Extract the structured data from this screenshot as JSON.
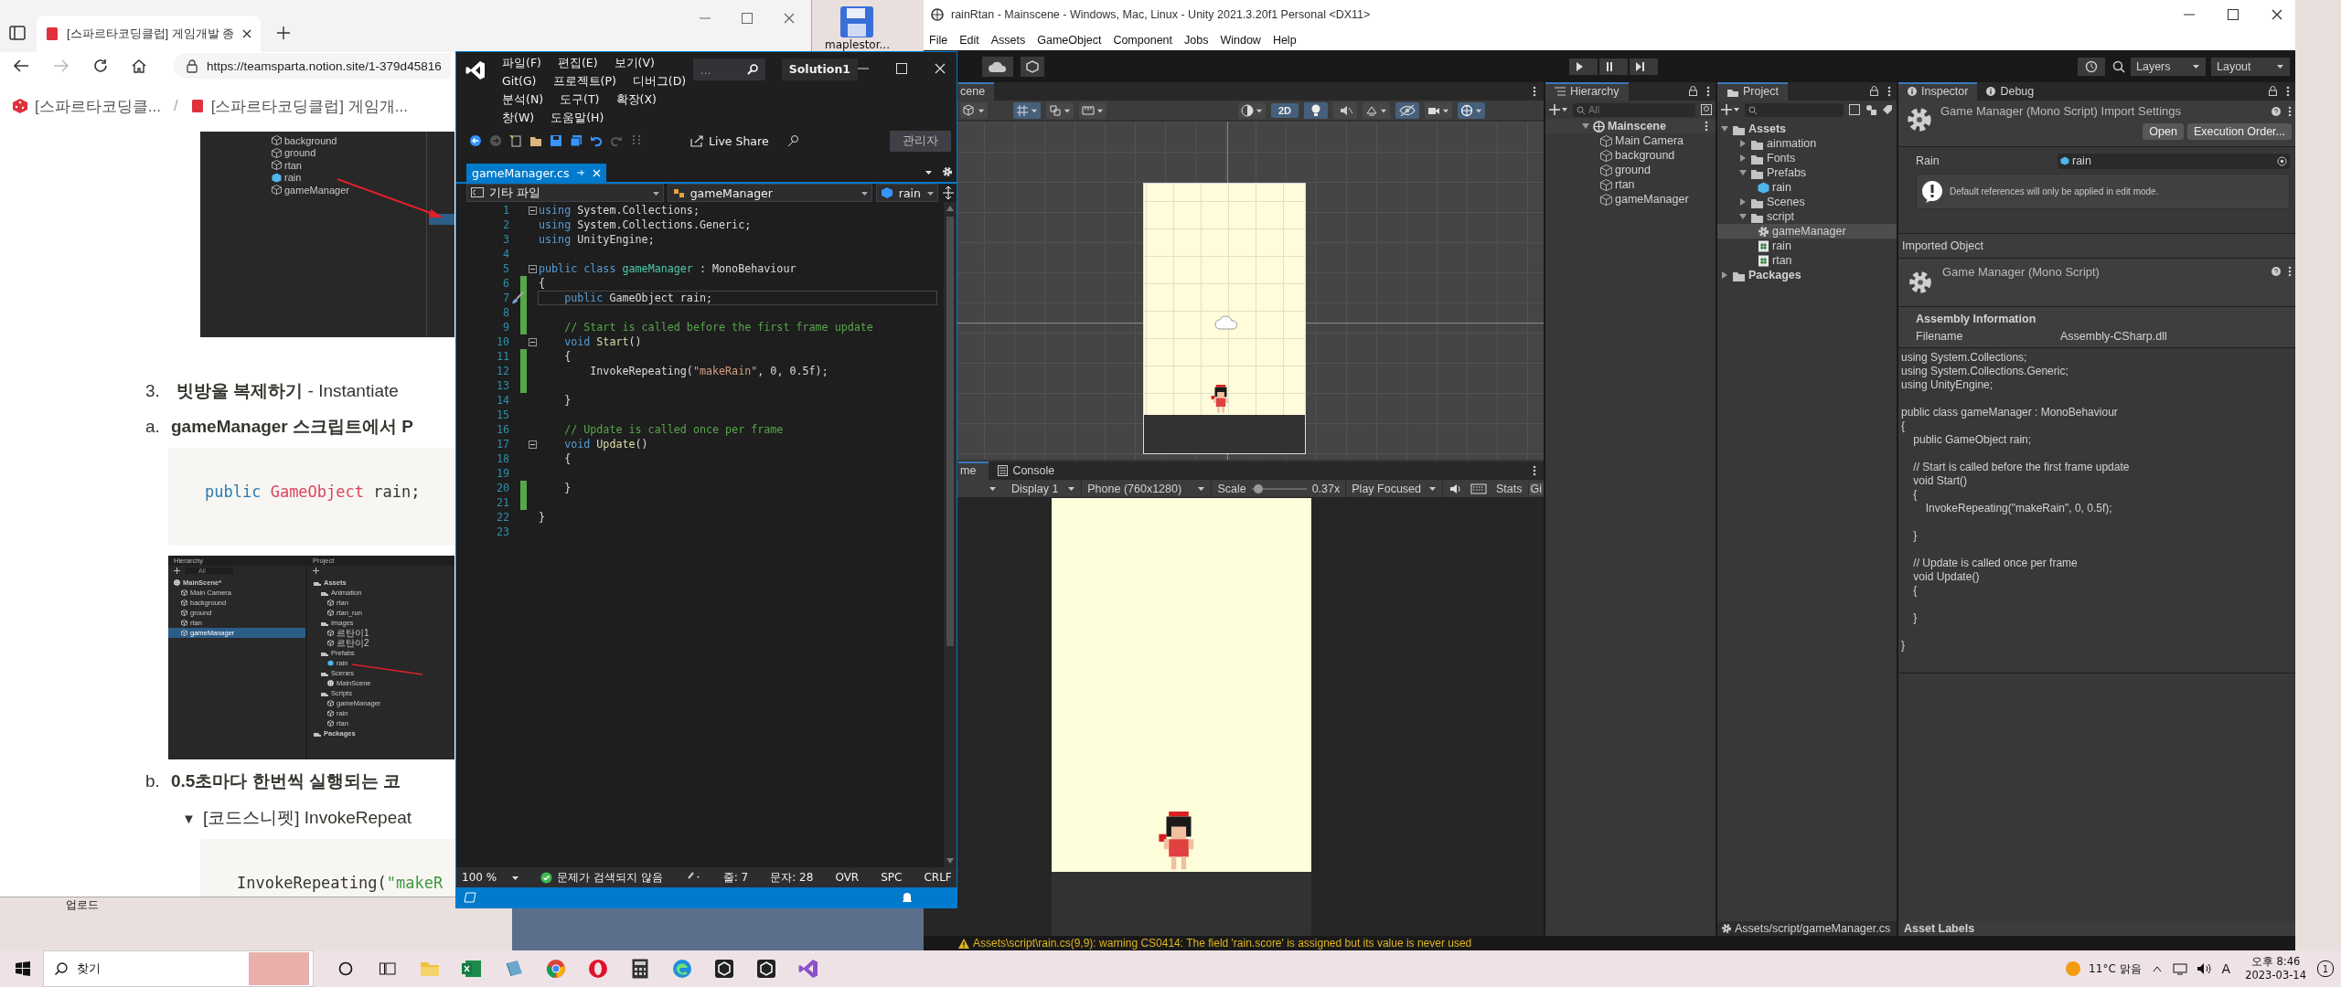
{
  "desktop_icons": [
    {
      "label": "maplestor..."
    },
    {
      "label": "업로드"
    }
  ],
  "browser": {
    "tab_title": "[스파르타코딩클럽] 게임개발 종",
    "address": "https://teamsparta.notion.site/1-379d45816",
    "breadcrumbs": [
      "[스파르타코딩클...",
      "[스파르타코딩클럽] 게임개..."
    ],
    "breadcrumb_separator": "/",
    "content": [
      {
        "kind": "screenshot_tree",
        "items": [
          {
            "label": "background",
            "kind": "object",
            "selected": false
          },
          {
            "label": "ground",
            "kind": "object",
            "selected": false
          },
          {
            "label": "rtan",
            "kind": "object",
            "selected": false
          },
          {
            "label": "rain",
            "kind": "prefab",
            "selected": false
          },
          {
            "label": "gameManager",
            "kind": "object",
            "selected": false
          }
        ]
      },
      {
        "kind": "heading",
        "number": "3.",
        "text": "**빗방울 복제하기** - Instantiate",
        "children": [
          {
            "kind": "subitem",
            "number": "a.",
            "text": "gameManager 스크립트에서 P",
            "children": [
              {
                "kind": "code",
                "tokens": [
                  {
                    "kind": "kw",
                    "text": "public "
                  },
                  {
                    "kind": "type",
                    "text": "GameObject"
                  },
                  {
                    "kind": "plain",
                    "text": " rain;"
                  }
                ]
              },
              {
                "kind": "screenshot_panels",
                "hierarchy": {
                  "title": "Hierarchy",
                  "search": "All",
                  "items": [
                    {
                      "label": "MainScene*",
                      "kind": "scene",
                      "selected": false,
                      "children": [
                        {
                          "label": "Main Camera",
                          "kind": "object",
                          "selected": false
                        },
                        {
                          "label": "background",
                          "kind": "object",
                          "selected": false
                        },
                        {
                          "label": "ground",
                          "kind": "object",
                          "selected": false
                        },
                        {
                          "label": "rtan",
                          "kind": "object",
                          "selected": false
                        },
                        {
                          "label": "gameManager",
                          "kind": "object",
                          "selected": true
                        }
                      ]
                    }
                  ]
                },
                "project": {
                  "title": "Project",
                  "items": [
                    {
                      "label": "Assets",
                      "kind": "folder",
                      "selected": false,
                      "children": [
                        {
                          "label": "Animation",
                          "kind": "folder",
                          "selected": false,
                          "children": [
                            {
                              "label": "rtan",
                              "kind": "object",
                              "selected": false
                            },
                            {
                              "label": "rtan_run",
                              "kind": "object",
                              "selected": false
                            }
                          ]
                        },
                        {
                          "label": "Images",
                          "kind": "folder",
                          "selected": false,
                          "children": [
                            {
                              "label": "르탄이1",
                              "kind": "object",
                              "selected": false
                            },
                            {
                              "label": "르탄이2",
                              "kind": "object",
                              "selected": false
                            }
                          ]
                        },
                        {
                          "label": "Prefabs",
                          "kind": "folder",
                          "selected": false,
                          "children": [
                            {
                              "label": "rain",
                              "kind": "prefab",
                              "selected": false
                            }
                          ]
                        },
                        {
                          "label": "Scenes",
                          "kind": "folder",
                          "selected": false,
                          "children": [
                            {
                              "label": "MainScene",
                              "kind": "scene",
                              "selected": false
                            }
                          ]
                        },
                        {
                          "label": "Scripts",
                          "kind": "folder",
                          "selected": false,
                          "children": [
                            {
                              "label": "gameManager",
                              "kind": "object",
                              "selected": false
                            },
                            {
                              "label": "rain",
                              "kind": "object",
                              "selected": false
                            },
                            {
                              "label": "rtan",
                              "kind": "object",
                              "selected": false
                            }
                          ]
                        }
                      ]
                    },
                    {
                      "label": "Packages",
                      "kind": "folder",
                      "selected": false
                    }
                  ]
                }
              }
            ]
          },
          {
            "kind": "subitem",
            "number": "b.",
            "text": "0.5초마다 한번씩 실행되는 코",
            "children": [
              {
                "kind": "toggle",
                "marker": "▼",
                "text": "[코드스니펫] InvokeRepeat",
                "expanded": true,
                "children": [
                  {
                    "kind": "code",
                    "tokens": [
                      {
                        "kind": "plain",
                        "text": "InvokeRepeating("
                      },
                      {
                        "kind": "str",
                        "text": "\"makeR"
                      }
                    ]
                  }
                ]
              }
            ]
          }
        ]
      }
    ]
  },
  "vs": {
    "menu": [
      "파일(F)",
      "편집(E)",
      "보기(V)",
      "Git(G)",
      "프로젝트(P)",
      "디버그(D)",
      "분석(N)",
      "도구(T)",
      "확장(X)",
      "창(W)",
      "도움말(H)"
    ],
    "search": "...",
    "solution": "Solution1",
    "live_share": "Live Share",
    "admin": "관리자",
    "tab": {
      "title": "gameManager.cs",
      "selected": true
    },
    "nav": [
      "기타 파일",
      "gameManager",
      "rain"
    ],
    "lines": [
      {
        "number": "1",
        "fold": true,
        "changed": false,
        "current": false,
        "tokens": [
          {
            "kind": "kw",
            "text": "using"
          },
          {
            "kind": "plain",
            "text": " System.Collections;"
          }
        ]
      },
      {
        "number": "2",
        "fold": false,
        "changed": false,
        "current": false,
        "tokens": [
          {
            "kind": "kw",
            "text": "using"
          },
          {
            "kind": "plain",
            "text": " System.Collections.Generic;"
          }
        ]
      },
      {
        "number": "3",
        "fold": false,
        "changed": false,
        "current": false,
        "tokens": [
          {
            "kind": "kw",
            "text": "using"
          },
          {
            "kind": "plain",
            "text": " UnityEngine;"
          }
        ]
      },
      {
        "number": "4",
        "fold": false,
        "changed": false,
        "current": false
      },
      {
        "number": "5",
        "fold": true,
        "changed": false,
        "current": false,
        "tokens": [
          {
            "kind": "kw",
            "text": "public class "
          },
          {
            "kind": "type",
            "text": "gameManager"
          },
          {
            "kind": "plain",
            "text": " : MonoBehaviour"
          }
        ]
      },
      {
        "number": "6",
        "fold": false,
        "changed": true,
        "current": false,
        "tokens": [
          {
            "kind": "plain",
            "text": "{"
          }
        ]
      },
      {
        "number": "7",
        "fold": false,
        "changed": true,
        "current": true,
        "tokens": [
          {
            "kind": "kw",
            "text": "    public"
          },
          {
            "kind": "plain",
            "text": " GameObject rain;"
          }
        ]
      },
      {
        "number": "8",
        "fold": false,
        "changed": true,
        "current": false
      },
      {
        "number": "9",
        "fold": false,
        "changed": true,
        "current": false,
        "tokens": [
          {
            "kind": "comment",
            "text": "    // Start is called before the first frame update"
          }
        ]
      },
      {
        "number": "10",
        "fold": true,
        "changed": false,
        "current": false,
        "tokens": [
          {
            "kind": "kw",
            "text": "    void"
          },
          {
            "kind": "method",
            "text": " Start"
          },
          {
            "kind": "plain",
            "text": "()"
          }
        ]
      },
      {
        "number": "11",
        "fold": false,
        "changed": true,
        "current": false,
        "tokens": [
          {
            "kind": "plain",
            "text": "    {"
          }
        ]
      },
      {
        "number": "12",
        "fold": false,
        "changed": true,
        "current": false,
        "tokens": [
          {
            "kind": "plain",
            "text": "        InvokeRepeating("
          },
          {
            "kind": "str",
            "text": "\"makeRain\""
          },
          {
            "kind": "plain",
            "text": ", 0, 0.5f);"
          }
        ]
      },
      {
        "number": "13",
        "fold": false,
        "changed": true,
        "current": false
      },
      {
        "number": "14",
        "fold": false,
        "changed": false,
        "current": false,
        "tokens": [
          {
            "kind": "plain",
            "text": "    }"
          }
        ]
      },
      {
        "number": "15",
        "fold": false,
        "changed": false,
        "current": false
      },
      {
        "number": "16",
        "fold": false,
        "changed": false,
        "current": false,
        "tokens": [
          {
            "kind": "comment",
            "text": "    // Update is called once per frame"
          }
        ]
      },
      {
        "number": "17",
        "fold": true,
        "changed": false,
        "current": false,
        "tokens": [
          {
            "kind": "kw",
            "text": "    void"
          },
          {
            "kind": "method",
            "text": " Update"
          },
          {
            "kind": "plain",
            "text": "()"
          }
        ]
      },
      {
        "number": "18",
        "fold": false,
        "changed": false,
        "current": false,
        "tokens": [
          {
            "kind": "plain",
            "text": "    {"
          }
        ]
      },
      {
        "number": "19",
        "fold": false,
        "changed": false,
        "current": false
      },
      {
        "number": "20",
        "fold": false,
        "changed": true,
        "current": false,
        "tokens": [
          {
            "kind": "plain",
            "text": "    }"
          }
        ]
      },
      {
        "number": "21",
        "fold": false,
        "changed": true,
        "current": false
      },
      {
        "number": "22",
        "fold": false,
        "changed": false,
        "current": false,
        "tokens": [
          {
            "kind": "plain",
            "text": "}"
          }
        ]
      },
      {
        "number": "23",
        "fold": false,
        "changed": false,
        "current": false
      }
    ],
    "status": {
      "zoom": "100 %",
      "issues": "문제가 검색되지 않음",
      "line": "줄: 7",
      "column": "문자: 28",
      "mode": "OVR",
      "whitespace": "SPC",
      "line_ending": "CRLF"
    }
  },
  "unity": {
    "title": "rainRtan - Mainscene - Windows, Mac, Linux - Unity 2021.3.20f1 Personal <DX11>",
    "menu": [
      "File",
      "Edit",
      "Assets",
      "GameObject",
      "Component",
      "Jobs",
      "Window",
      "Help"
    ],
    "layers": "Layers",
    "layout": "Layout",
    "scene": {
      "tab": "cene",
      "toolbar_2d": "2D",
      "mode_2d": true
    },
    "game": {
      "tabs": [
        {
          "label": "me",
          "selected": true
        },
        {
          "label": "Console",
          "selected": false
        }
      ],
      "display": "Display 1",
      "resolution": "Phone (760x1280)",
      "scale_label": "Scale",
      "scale": {
        "level": 0.05
      },
      "scale_value": "0.37x",
      "play_mode": "Play Focused",
      "stats": "Stats",
      "gizmos": "Gi"
    },
    "hierarchy": {
      "title": "Hierarchy",
      "search_placeholder": "All",
      "items": [
        {
          "label": "Mainscene",
          "kind": "scene",
          "expanded": true,
          "selected": false,
          "children": [
            {
              "label": "Main Camera",
              "kind": "object",
              "selected": false
            },
            {
              "label": "background",
              "kind": "object",
              "selected": false
            },
            {
              "label": "ground",
              "kind": "object",
              "selected": false
            },
            {
              "label": "rtan",
              "kind": "object",
              "selected": false
            },
            {
              "label": "gameManager",
              "kind": "object",
              "selected": false
            }
          ]
        }
      ]
    },
    "project": {
      "title": "Project",
      "items": [
        {
          "label": "Assets",
          "kind": "folder",
          "expanded": true,
          "selected": false,
          "children": [
            {
              "label": "ainmation",
              "kind": "folder",
              "expanded": false,
              "selected": false
            },
            {
              "label": "Fonts",
              "kind": "folder",
              "expanded": false,
              "selected": false
            },
            {
              "label": "Prefabs",
              "kind": "folder",
              "expanded": true,
              "selected": false,
              "children": [
                {
                  "label": "rain",
                  "kind": "prefab",
                  "selected": false
                }
              ]
            },
            {
              "label": "Scenes",
              "kind": "folder",
              "expanded": false,
              "selected": false
            },
            {
              "label": "script",
              "kind": "folder",
              "expanded": true,
              "selected": false,
              "children": [
                {
                  "label": "gameManager",
                  "kind": "gear",
                  "selected": true
                },
                {
                  "label": "rain",
                  "kind": "script",
                  "selected": false
                },
                {
                  "label": "rtan",
                  "kind": "script",
                  "selected": false
                }
              ]
            }
          ]
        },
        {
          "label": "Packages",
          "kind": "folder",
          "expanded": false,
          "selected": false
        }
      ],
      "path": "Assets/script/gameManager.cs"
    },
    "inspector": {
      "tabs": [
        {
          "label": "Inspector",
          "selected": true
        },
        {
          "label": "Debug",
          "selected": false
        }
      ],
      "title": "Game Manager (Mono Script) Import Settings",
      "buttons": [
        "Open",
        "Execution Order..."
      ],
      "field": {
        "label": "Rain",
        "value": "rain"
      },
      "info": "Default references will only be applied in edit mode.",
      "imported_header": "Imported Object",
      "imported_title": "Game Manager (Mono Script)",
      "assembly_header": "Assembly Information",
      "assembly_label": "Filename",
      "assembly_value": "Assembly-CSharp.dll",
      "preview": "using System.Collections;\nusing System.Collections.Generic;\nusing UnityEngine;\n\npublic class gameManager : MonoBehaviour\n{\n    public GameObject rain;\n\n    // Start is called before the first frame update\n    void Start()\n    {\n        InvokeRepeating(\"makeRain\", 0, 0.5f);\n\n    }\n\n    // Update is called once per frame\n    void Update()\n    {\n\n    }\n\n}",
      "labels_header": "Asset Labels"
    },
    "status": {
      "kind": "warning",
      "message": "Assets\\script\\rain.cs(9,9): warning CS0414: The field 'rain.score' is assigned but its value is never used"
    }
  },
  "taskbar": {
    "search_placeholder": "찾기",
    "apps": [
      {
        "kind": "circle"
      },
      {
        "kind": "taskview"
      },
      {
        "kind": "folder"
      },
      {
        "kind": "sheet"
      },
      {
        "kind": "book"
      },
      {
        "kind": "chrome"
      },
      {
        "kind": "opera"
      },
      {
        "kind": "calculator"
      },
      {
        "kind": "edge"
      },
      {
        "kind": "unity"
      },
      {
        "kind": "unity"
      },
      {
        "kind": "vs"
      }
    ],
    "weather": "11°C 맑음",
    "ime": "A",
    "time": "오후 8:46",
    "date": "2023-03-14",
    "notifications": "1"
  }
}
